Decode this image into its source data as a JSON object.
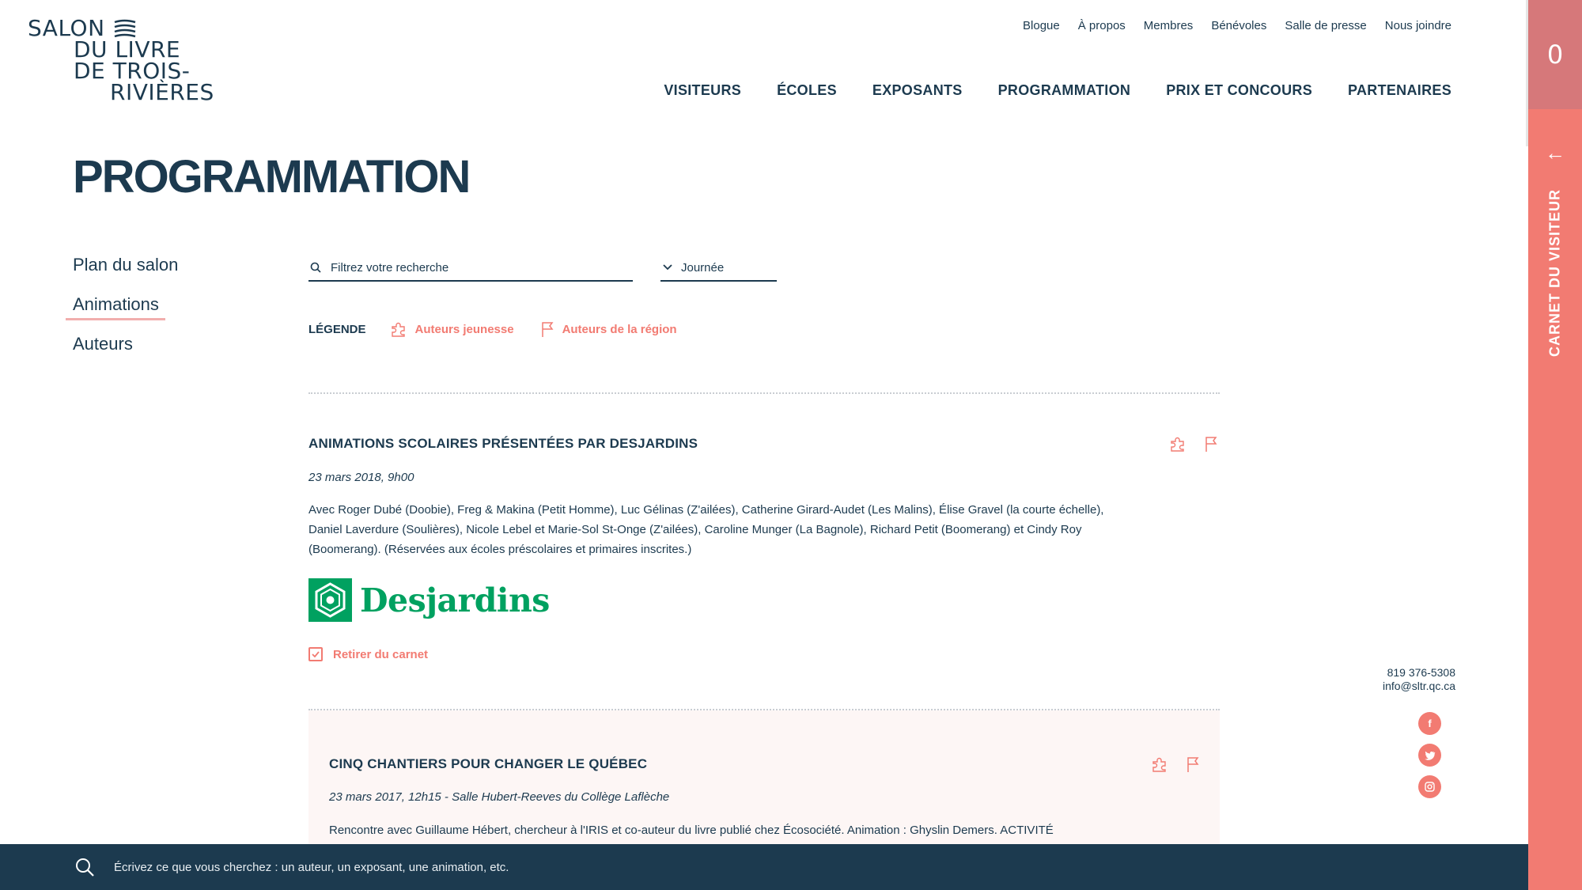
{
  "logo": {
    "line1": "SALON",
    "line2": "DU LIVRE",
    "line3": "DE TROIS-",
    "line4": "RIVIÈRES"
  },
  "topnav": [
    "Blogue",
    "À propos",
    "Membres",
    "Bénévoles",
    "Salle de presse",
    "Nous joindre"
  ],
  "mainnav": [
    "VISITEURS",
    "ÉCOLES",
    "EXPOSANTS",
    "PROGRAMMATION",
    "PRIX ET CONCOURS",
    "PARTENAIRES"
  ],
  "panel": {
    "count": "0",
    "arrow": "←",
    "label": "CARNET DU VISITEUR"
  },
  "page": {
    "title": "PROGRAMMATION"
  },
  "sidemenu": [
    "Plan du salon",
    "Animations",
    "Auteurs"
  ],
  "filters": {
    "search_placeholder": "Filtrez votre recherche",
    "day_label": "Journée"
  },
  "legend": {
    "label": "LÉGENDE",
    "youth": "Auteurs jeunesse",
    "region": "Auteurs de la région"
  },
  "events": [
    {
      "title": "ANIMATIONS SCOLAIRES PRÉSENTÉES PAR DESJARDINS",
      "date": "23 mars 2018, 9h00",
      "desc1": "Avec Roger Dubé (Doobie), Freg & Makina (Petit Homme), Luc Gélinas (Z'ailées), Catherine Girard-Audet (Les Malins), Élise Gravel (la courte échelle),",
      "desc2": "Daniel Laverdure (Soulières), Nicole Lebel et Marie-Sol St-Onge (Z'ailées), Caroline Munger (La Bagnole), Richard Petit (Boomerang) et Cindy Roy",
      "desc3": "(Boomerang). (Réservées aux écoles préscolaires et primaires inscrites.)",
      "sponsor": "Desjardins",
      "action": "Retirer du carnet"
    },
    {
      "title": "CINQ CHANTIERS POUR CHANGER LE QUÉBEC",
      "date": "23 mars 2017, 12h15 - Salle Hubert-Reeves du Collège Laflèche",
      "desc1": "Rencontre avec Guillaume Hébert, chercheur à l'IRIS et co-auteur du livre publié chez Écosociété. Animation : Ghyslin Demers. ACTIVITÉ"
    }
  ],
  "contact": {
    "phone": "819 376-5308",
    "email": "info@sltr.qc.ca"
  },
  "social": [
    "facebook-icon",
    "twitter-icon",
    "instagram-icon"
  ],
  "bottom_search": {
    "placeholder": "Écrivez ce que vous cherchez : un auteur, un exposant, une animation, etc."
  },
  "colors": {
    "navy": "#1c3a4f",
    "coral": "#f27b72",
    "sponsor_green": "#00a160"
  }
}
